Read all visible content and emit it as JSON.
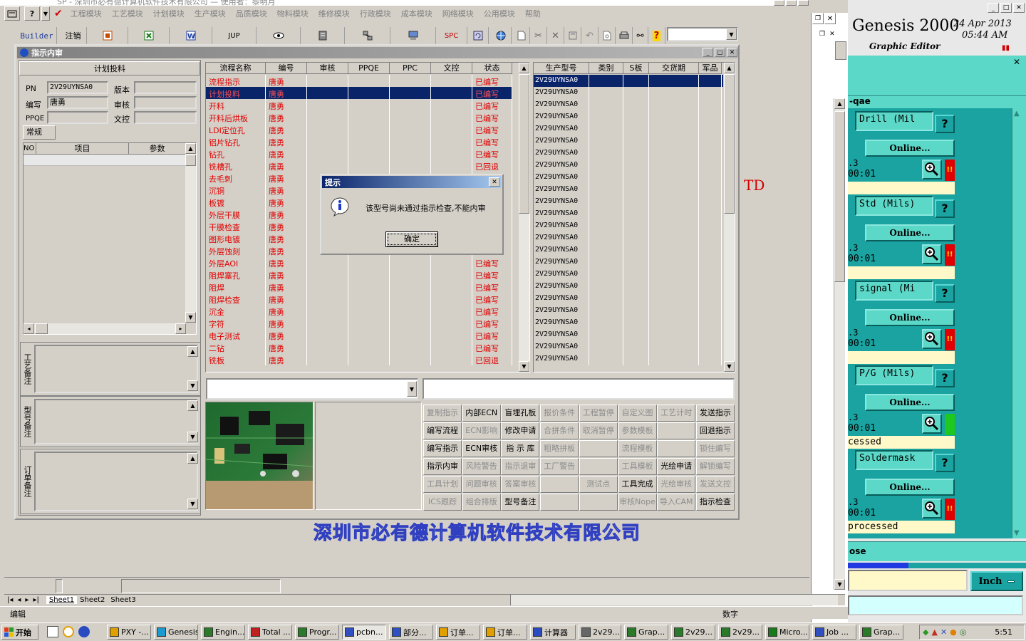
{
  "title_bar": {
    "text": "SP - 深圳市必有德计算机软件技术有限公司 — 使用者：黎明月"
  },
  "menu": [
    "工程模块",
    "工艺模块",
    "计划模块",
    "生产模块",
    "品质模块",
    "物料模块",
    "维修模块",
    "行政模块",
    "成本模块",
    "网络模块",
    "公用模块",
    "帮助"
  ],
  "toolbar": {
    "builder": "Builder",
    "logout": "注销",
    "jup": "JUP",
    "spc": "SPC"
  },
  "dialog_window": {
    "title": "指示内审"
  },
  "left_panel": {
    "group_title": "计划投料",
    "fields": {
      "pn_label": "PN",
      "pn_value": "2V29UYNSA0",
      "version_label": "版本",
      "version_value": "",
      "code_label": "编写",
      "code_value": "唐勇",
      "review_label": "审核",
      "review_value": "",
      "ppqe_label": "PPQE",
      "ppqe_value": "",
      "doc_label": "文控",
      "doc_value": ""
    },
    "tab": "常规",
    "params_headers": [
      "NO",
      "项目",
      "参数"
    ],
    "notes": [
      "工艺备注",
      "型号备注",
      "订单备注"
    ]
  },
  "process_table": {
    "headers": [
      "流程名称",
      "编号",
      "审核",
      "PPQE",
      "PPC",
      "文控",
      "状态"
    ],
    "rows": [
      {
        "name": "流程指示",
        "code": "唐勇",
        "status": "已编写"
      },
      {
        "name": "计划投料",
        "code": "唐勇",
        "status": "已编写",
        "selected": true
      },
      {
        "name": "开料",
        "code": "唐勇",
        "status": "已编写"
      },
      {
        "name": "开料后烘板",
        "code": "唐勇",
        "status": "已编写"
      },
      {
        "name": "LDI定位孔",
        "code": "唐勇",
        "status": "已编写"
      },
      {
        "name": "铝片钻孔",
        "code": "唐勇",
        "status": "已编写"
      },
      {
        "name": "钻孔",
        "code": "唐勇",
        "status": "已编写"
      },
      {
        "name": "铣槽孔",
        "code": "唐勇",
        "status": "已回退"
      },
      {
        "name": "去毛刺",
        "code": "唐勇",
        "status": ""
      },
      {
        "name": "沉铜",
        "code": "唐勇",
        "status": ""
      },
      {
        "name": "板镀",
        "code": "唐勇",
        "status": ""
      },
      {
        "name": "外层干膜",
        "code": "唐勇",
        "status": ""
      },
      {
        "name": "干膜检查",
        "code": "唐勇",
        "status": ""
      },
      {
        "name": "图形电镀",
        "code": "唐勇",
        "status": ""
      },
      {
        "name": "外层蚀刻",
        "code": "唐勇",
        "status": ""
      },
      {
        "name": "外层AOI",
        "code": "唐勇",
        "status": "已编写"
      },
      {
        "name": "阻焊塞孔",
        "code": "唐勇",
        "status": "已编写"
      },
      {
        "name": "阻焊",
        "code": "唐勇",
        "status": "已编写"
      },
      {
        "name": "阻焊检查",
        "code": "唐勇",
        "status": "已编写"
      },
      {
        "name": "沉金",
        "code": "唐勇",
        "status": "已编写"
      },
      {
        "name": "字符",
        "code": "唐勇",
        "status": "已编写"
      },
      {
        "name": "电子测试",
        "code": "唐勇",
        "status": "已编写"
      },
      {
        "name": "二钻",
        "code": "唐勇",
        "status": "已编写"
      },
      {
        "name": "铣板",
        "code": "唐勇",
        "status": "已回退"
      }
    ]
  },
  "model_table": {
    "headers": [
      "生产型号",
      "类别",
      "S板",
      "交货期",
      "军品"
    ],
    "rows": [
      "2V29UYNSA0",
      "2V29UYNSA0",
      "2V29UYNSA0",
      "2V29UYNSA0",
      "2V29UYNSA0",
      "2V29UYNSA0",
      "2V29UYNSA0",
      "2V29UYNSA0",
      "2V29UYNSA0",
      "2V29UYNSA0",
      "2V29UYNSA0",
      "2V29UYNSA0",
      "2V29UYNSA0",
      "2V29UYNSA0",
      "2V29UYNSA0",
      "2V29UYNSA0",
      "2V29UYNSA0",
      "2V29UYNSA0",
      "2V29UYNSA0",
      "2V29UYNSA0",
      "2V29UYNSA0",
      "2V29UYNSA0",
      "2V29UYNSA0",
      "2V29UYNSA0"
    ]
  },
  "alert": {
    "title": "提示",
    "message": "该型号尚未通过指示检查,不能内审",
    "ok": "确定"
  },
  "action_buttons": [
    [
      {
        "t": "复制指示",
        "d": true
      },
      {
        "t": "内部ECN",
        "d": false
      },
      {
        "t": "盲埋孔板",
        "d": false
      },
      {
        "t": "报价条件",
        "d": true
      },
      {
        "t": "工程暂停",
        "d": true
      },
      {
        "t": "自定义图",
        "d": true
      },
      {
        "t": "工艺计时",
        "d": true
      },
      {
        "t": "发送指示",
        "d": false
      }
    ],
    [
      {
        "t": "编写流程",
        "d": false
      },
      {
        "t": "ECN影响",
        "d": true
      },
      {
        "t": "修改申请",
        "d": false
      },
      {
        "t": "合拼条件",
        "d": true
      },
      {
        "t": "取消暂停",
        "d": true
      },
      {
        "t": "参数模板",
        "d": true
      },
      {
        "t": "",
        "d": true
      },
      {
        "t": "回退指示",
        "d": false
      }
    ],
    [
      {
        "t": "编写指示",
        "d": false
      },
      {
        "t": "ECN审核",
        "d": false
      },
      {
        "t": "指 示 库",
        "d": false
      },
      {
        "t": "粗略拼板",
        "d": true
      },
      {
        "t": "",
        "d": true
      },
      {
        "t": "流程模板",
        "d": true
      },
      {
        "t": "",
        "d": true
      },
      {
        "t": "锁住编写",
        "d": true
      }
    ],
    [
      {
        "t": "指示内审",
        "d": false
      },
      {
        "t": "风险警告",
        "d": true
      },
      {
        "t": "指示退审",
        "d": true
      },
      {
        "t": "工厂警告",
        "d": true
      },
      {
        "t": "",
        "d": true
      },
      {
        "t": "工具模板",
        "d": true
      },
      {
        "t": "光绘申请",
        "d": false
      },
      {
        "t": "解锁编写",
        "d": true
      }
    ],
    [
      {
        "t": "工具计划",
        "d": true
      },
      {
        "t": "问题审核",
        "d": true
      },
      {
        "t": "答案审核",
        "d": true
      },
      {
        "t": "",
        "d": true
      },
      {
        "t": "测试点",
        "d": true
      },
      {
        "t": "工具完成",
        "d": false
      },
      {
        "t": "光绘审核",
        "d": true
      },
      {
        "t": "发送文控",
        "d": true
      }
    ],
    [
      {
        "t": "ICS跟踪",
        "d": true
      },
      {
        "t": "组合排版",
        "d": true
      },
      {
        "t": "型号备注",
        "d": false
      },
      {
        "t": "",
        "d": true
      },
      {
        "t": "",
        "d": true
      },
      {
        "t": "审核Nope",
        "d": true
      },
      {
        "t": "导入CAM",
        "d": true
      },
      {
        "t": "指示检查",
        "d": false
      }
    ]
  ],
  "company_banner": "深圳市必有德计算机软件技术有限公司",
  "excel": {
    "sheets": [
      "Sheet1",
      "Sheet2",
      "Sheet3"
    ],
    "status_left": "编辑",
    "status_right": "数字",
    "td_text": "TD"
  },
  "genesis": {
    "title": "Genesis 2000",
    "subtitle": "Graphic Editor",
    "date": "24 Apr 2013",
    "time": "05:44 AM",
    "job": "-qae",
    "steps": [
      {
        "name": "Drill (Mil",
        "status": "Online...",
        "num": ".3",
        "time": "00:01",
        "flag": "!!",
        "flag_color": "#e00000",
        "foot": ""
      },
      {
        "name": "Std (Mils)",
        "status": "Online...",
        "num": ".3",
        "time": "00:01",
        "flag": "!!",
        "flag_color": "#e00000",
        "foot": ""
      },
      {
        "name": "signal (Mi",
        "status": "Online...",
        "num": ".3",
        "time": "00:01",
        "flag": "!!",
        "flag_color": "#e00000",
        "foot": ""
      },
      {
        "name": "P/G (Mils)",
        "status": "Online...",
        "num": ".3",
        "time": "00:01",
        "flag": "",
        "flag_color": "#1ec81e",
        "foot": "cessed"
      },
      {
        "name": "Soldermask",
        "status": "Online...",
        "num": ".3",
        "time": "00:01",
        "flag": "!!",
        "flag_color": "#e00000",
        "foot": "processed"
      }
    ],
    "close_label": "ose",
    "unit": "Inch",
    "progress": 0.55
  },
  "taskbar": {
    "start": "开始",
    "items": [
      "PXY -...",
      "Genesis",
      "Engin...",
      "Total ...",
      "Progr...",
      "pcbn...",
      "部分...",
      "订单...",
      "订单...",
      "计算器",
      "2v29...",
      "Grap...",
      "2v29...",
      "2v29...",
      "Micro...",
      "Job ...",
      "Grap..."
    ],
    "clock": "5:51"
  }
}
